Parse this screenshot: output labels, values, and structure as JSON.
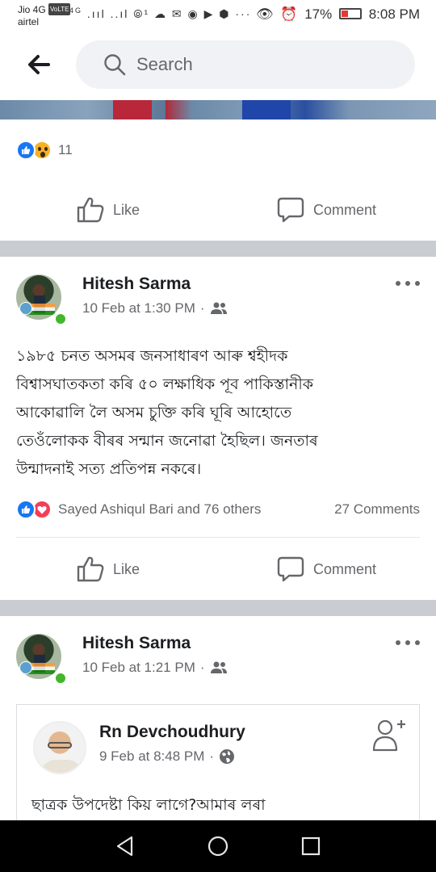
{
  "status_bar": {
    "carrier_top": "Jio 4G",
    "volte": "VoLTE",
    "carrier_bottom": "airtel",
    "network": "4G",
    "signal_icons": ".ııl ..ıl ⦾¹",
    "notification_icons": "☁ ✉ ◉ ▶ ⬢ ···",
    "battery_percent": "17%",
    "time": "8:08 PM"
  },
  "header": {
    "search_placeholder": "Search"
  },
  "post_top": {
    "reaction_count": "11",
    "like_label": "Like",
    "comment_label": "Comment"
  },
  "post_1": {
    "author": "Hitesh Sarma",
    "date": "10 Feb at 1:30 PM",
    "audience_icon": "friends-icon",
    "text": "১৯৮৫ চনত অসমৰ জনসাধাৰণ আৰু শ্বহীদক\nবিশ্বাসঘাতকতা কৰি ৫০ লক্ষাধিক পূব পাকিস্তানীক\nআকোৱালি লৈ অসম চুক্তি কৰি ঘূৰি আহোতে\nতেওঁলোকক বীৰৰ সন্মান জনোৱা হৈছিল। জনতাৰ\nউন্মাদনাই সত্য প্ৰতিপন্ন নকৰে।",
    "reactions_text": "Sayed Ashiqul Bari and 76 others",
    "comments_text": "27 Comments",
    "like_label": "Like",
    "comment_label": "Comment"
  },
  "post_2": {
    "author": "Hitesh Sarma",
    "date": "10 Feb at 1:21 PM",
    "audience_icon": "friends-icon",
    "shared": {
      "author": "Rn Devchoudhury",
      "date": "9 Feb at 8:48 PM",
      "audience_icon": "globe-icon",
      "text": "ছাত্ৰক উপদেষ্টা কিয় লাগে?আমাৰ লৰা"
    }
  },
  "colors": {
    "facebook_blue": "#1877f2",
    "love_red": "#f33e58",
    "wow_yellow": "#f7b125",
    "online_green": "#42b72a",
    "separator_gray": "#c9ccd1"
  }
}
